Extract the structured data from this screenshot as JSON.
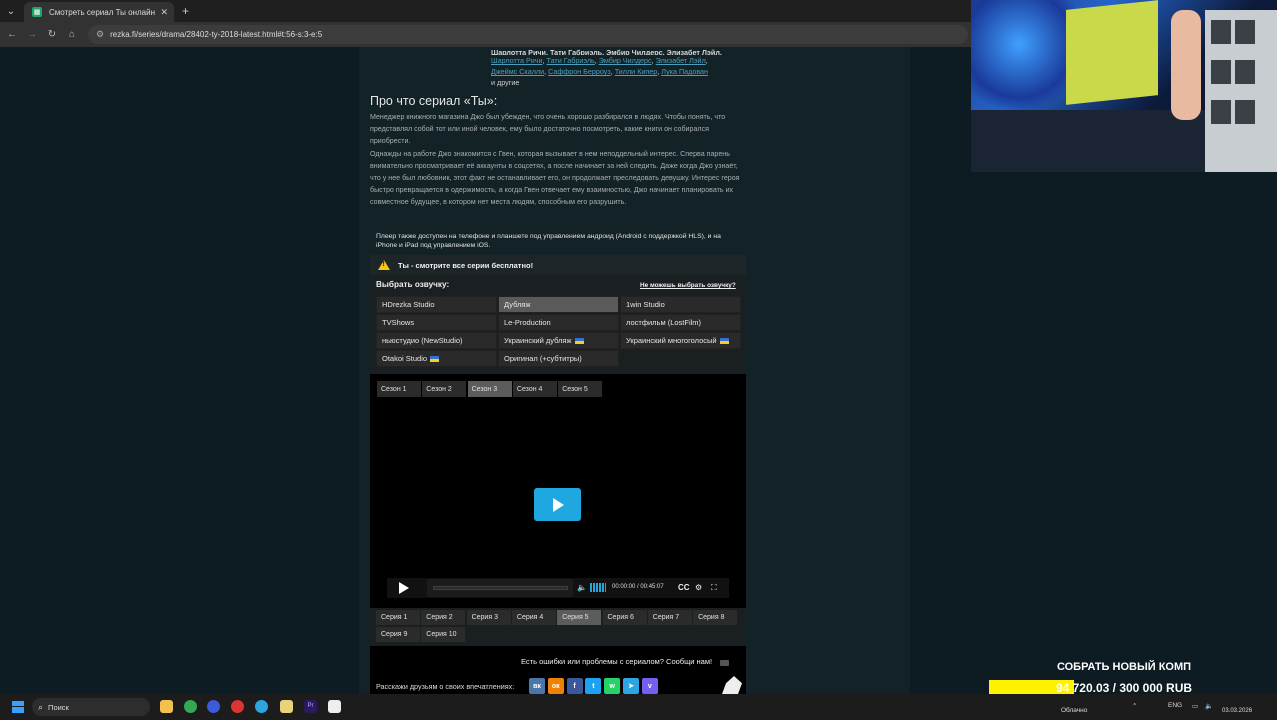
{
  "browser": {
    "tab_title": "Смотреть сериал Ты онлайн б",
    "url": "rezka.fi/series/drama/28402-ty-2018-latest.html#t:56-s:3-e:5"
  },
  "cast": {
    "cut_line": "Шарлотта Ричи, Тати Габриэль, Эмбир Чилдерс, Элизабет Лэйл,",
    "actors_line1": [
      "Шарлотта Ричи",
      "Тати Габриэль",
      "Эмбир Чилдерс",
      "Элизабет Лэйл"
    ],
    "actors_line2": [
      "Джеймс Скалли",
      "Саффрон Берроуз",
      "Тилли Кипер",
      "Лука Падован"
    ],
    "more": "и другие"
  },
  "about": {
    "heading": "Про что сериал «Ты»:",
    "text": "Менеджер книжного магазина Джо был убежден, что очень хорошо разбирался в людях. Чтобы понять, что представлял собой тот или иной человек, ему было достаточно посмотреть, какие книги он собирался приобрести.",
    "text2": "Однажды на работе Джо знакомится с Гвен, которая вызывает в нем неподдельный интерес. Сперва парень внимательно просматривает её аккаунты в соцсетях, а после начинает за ней следить. Даже когда Джо узнаёт, что у нее был любовник, этот факт не останавливает его, он продолжает преследовать девушку. Интерес героя быстро превращается в одержимость, а когда Гвен отвечает ему взаимностью, Джо начинает планировать их совместное будущее, в котором нет места людям, способным его разрушить."
  },
  "player_note": "Плеер также доступен на телефоне и планшете под управлением андроид (Android с поддержкой HLS), и на iPhone и iPad под управлением iOS.",
  "free_notice": "Ты - смотрите все серии бесплатно!",
  "voice": {
    "heading": "Выбрать озвучку:",
    "help_link": "Не можешь выбрать озвучку?",
    "options": [
      {
        "label": "HDrezka Studio",
        "flag": false,
        "selected": false
      },
      {
        "label": "Дубляж",
        "flag": false,
        "selected": true
      },
      {
        "label": "1win Studio",
        "flag": false,
        "selected": false
      },
      {
        "label": "TVShows",
        "flag": false,
        "selected": false
      },
      {
        "label": "Le-Production",
        "flag": false,
        "selected": false
      },
      {
        "label": "лостфильм (LostFilm)",
        "flag": false,
        "selected": false
      },
      {
        "label": "ньюстудио (NewStudio)",
        "flag": false,
        "selected": false
      },
      {
        "label": "Украинский дубляж",
        "flag": true,
        "selected": false
      },
      {
        "label": "Украинский многоголосый",
        "flag": true,
        "selected": false
      },
      {
        "label": "Otakoi Studio",
        "flag": true,
        "selected": false
      },
      {
        "label": "Оригинал (+субтитры)",
        "flag": false,
        "selected": false
      }
    ]
  },
  "seasons": {
    "items": [
      "Сезон 1",
      "Сезон 2",
      "Сезон 3",
      "Сезон 4",
      "Сезон 5"
    ],
    "selected": "Сезон 3"
  },
  "controls": {
    "time": "00:00:00 / 00:45:07",
    "cc_label": "CC"
  },
  "episodes": {
    "items": [
      "Серия 1",
      "Серия 2",
      "Серия 3",
      "Серия 4",
      "Серия 5",
      "Серия 6",
      "Серия 7",
      "Серия 8",
      "Серия 9",
      "Серия 10"
    ],
    "selected": "Серия 5"
  },
  "errors_text": "Есть ошибки или проблемы с сериалом? Сообщи нам!",
  "share": {
    "label": "Расскажи друзьям о своих впечатлениях:",
    "networks": [
      {
        "name": "vk-icon",
        "glyph": "вк",
        "color": "#4a76a8"
      },
      {
        "name": "odnoklassniki-icon",
        "glyph": "ок",
        "color": "#ee8208"
      },
      {
        "name": "facebook-icon",
        "glyph": "f",
        "color": "#3b5998"
      },
      {
        "name": "twitter-icon",
        "glyph": "t",
        "color": "#1da1f2"
      },
      {
        "name": "whatsapp-icon",
        "glyph": "w",
        "color": "#25d366"
      },
      {
        "name": "telegram-icon",
        "glyph": "➤",
        "color": "#2ca5e0"
      },
      {
        "name": "viber-icon",
        "glyph": "v",
        "color": "#7360f2"
      }
    ]
  },
  "goal": {
    "title": "СОБРАТЬ НОВЫЙ КОМП",
    "text": "94 720.03 / 300 000 RUB",
    "progress": 0.3157,
    "fill_color": "#fff200"
  },
  "taskbar": {
    "search_placeholder": "Поиск",
    "weather": "Облачно",
    "lang": "ENG",
    "date": "03.03.2026"
  }
}
